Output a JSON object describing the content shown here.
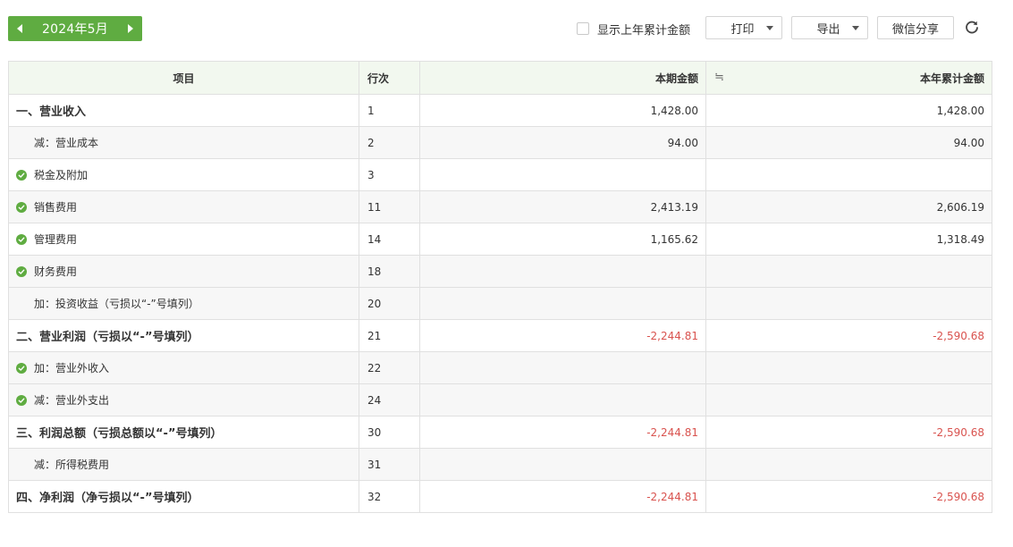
{
  "toolbar": {
    "period": "2024年5月",
    "show_prev_year_label": "显示上年累计金额",
    "show_prev_year_checked": false,
    "print_label": "打印",
    "export_label": "导出",
    "share_label": "微信分享"
  },
  "table": {
    "headers": {
      "item": "项目",
      "row": "行次",
      "current": "本期金额",
      "ytd_prefix": "≒",
      "ytd": "本年累计金额"
    },
    "rows": [
      {
        "item": "一、营业收入",
        "row": "1",
        "current": "1,428.00",
        "ytd": "1,428.00",
        "bold": true,
        "icon": false,
        "indent": false,
        "negative": false
      },
      {
        "item": "减：营业成本",
        "row": "2",
        "current": "94.00",
        "ytd": "94.00",
        "bold": false,
        "icon": false,
        "indent": true,
        "negative": false
      },
      {
        "item": "税金及附加",
        "row": "3",
        "current": "",
        "ytd": "",
        "bold": false,
        "icon": true,
        "indent": false,
        "negative": false
      },
      {
        "item": "销售费用",
        "row": "11",
        "current": "2,413.19",
        "ytd": "2,606.19",
        "bold": false,
        "icon": true,
        "indent": false,
        "negative": false
      },
      {
        "item": "管理费用",
        "row": "14",
        "current": "1,165.62",
        "ytd": "1,318.49",
        "bold": false,
        "icon": true,
        "indent": false,
        "negative": false
      },
      {
        "item": "财务费用",
        "row": "18",
        "current": "",
        "ytd": "",
        "bold": false,
        "icon": true,
        "indent": false,
        "negative": false
      },
      {
        "item": "加：投资收益（亏损以“-”号填列）",
        "row": "20",
        "current": "",
        "ytd": "",
        "bold": false,
        "icon": false,
        "indent": true,
        "negative": false
      },
      {
        "item": "二、营业利润（亏损以“-”号填列）",
        "row": "21",
        "current": "-2,244.81",
        "ytd": "-2,590.68",
        "bold": true,
        "icon": false,
        "indent": false,
        "negative": true
      },
      {
        "item": "加：营业外收入",
        "row": "22",
        "current": "",
        "ytd": "",
        "bold": false,
        "icon": true,
        "indent": false,
        "negative": false
      },
      {
        "item": "减：营业外支出",
        "row": "24",
        "current": "",
        "ytd": "",
        "bold": false,
        "icon": true,
        "indent": false,
        "negative": false
      },
      {
        "item": "三、利润总额（亏损总额以“-”号填列）",
        "row": "30",
        "current": "-2,244.81",
        "ytd": "-2,590.68",
        "bold": true,
        "icon": false,
        "indent": false,
        "negative": true
      },
      {
        "item": "减：所得税费用",
        "row": "31",
        "current": "",
        "ytd": "",
        "bold": false,
        "icon": false,
        "indent": true,
        "negative": false
      },
      {
        "item": "四、净利润（净亏损以“-”号填列）",
        "row": "32",
        "current": "-2,244.81",
        "ytd": "-2,590.68",
        "bold": true,
        "icon": false,
        "indent": false,
        "negative": true
      }
    ]
  },
  "colors": {
    "accent": "#5fac41",
    "header_bg": "#f2f8ef",
    "negative": "#d9534f",
    "border": "#e0e0e0"
  },
  "icons": {
    "prev": "caret-left-icon",
    "next": "caret-right-icon",
    "refresh": "refresh-icon",
    "row_mark": "check-circle-icon"
  }
}
